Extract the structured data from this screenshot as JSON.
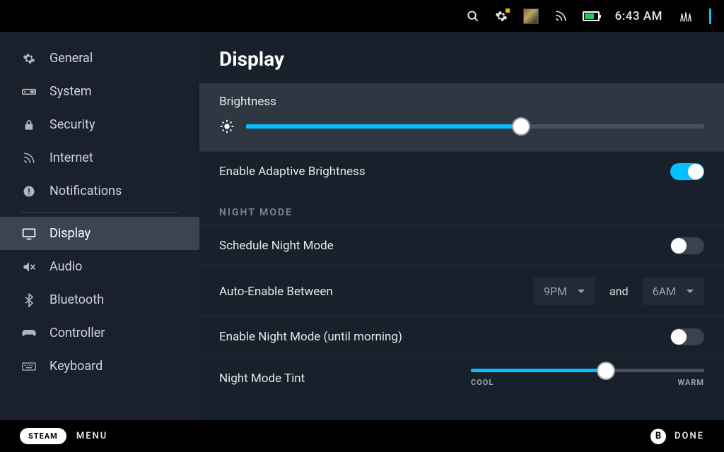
{
  "topbar": {
    "clock": "6:43 AM"
  },
  "sidebar": {
    "items": [
      {
        "label": "General"
      },
      {
        "label": "System"
      },
      {
        "label": "Security"
      },
      {
        "label": "Internet"
      },
      {
        "label": "Notifications"
      },
      {
        "label": "Display"
      },
      {
        "label": "Audio"
      },
      {
        "label": "Bluetooth"
      },
      {
        "label": "Controller"
      },
      {
        "label": "Keyboard"
      }
    ]
  },
  "display": {
    "title": "Display",
    "brightness_label": "Brightness",
    "brightness_value_pct": 60,
    "adaptive_label": "Enable Adaptive Brightness",
    "adaptive_on": true,
    "night_section": "NIGHT MODE",
    "schedule_label": "Schedule Night Mode",
    "schedule_on": false,
    "auto_label": "Auto-Enable Between",
    "auto_from": "9PM",
    "auto_and": "and",
    "auto_to": "6AM",
    "enable_until_label": "Enable Night Mode (until morning)",
    "enable_until_on": false,
    "tint_label": "Night Mode Tint",
    "tint_value_pct": 58,
    "tint_cool": "COOL",
    "tint_warm": "WARM"
  },
  "footer": {
    "steam": "STEAM",
    "menu": "MENU",
    "done_btn": "B",
    "done": "DONE"
  }
}
